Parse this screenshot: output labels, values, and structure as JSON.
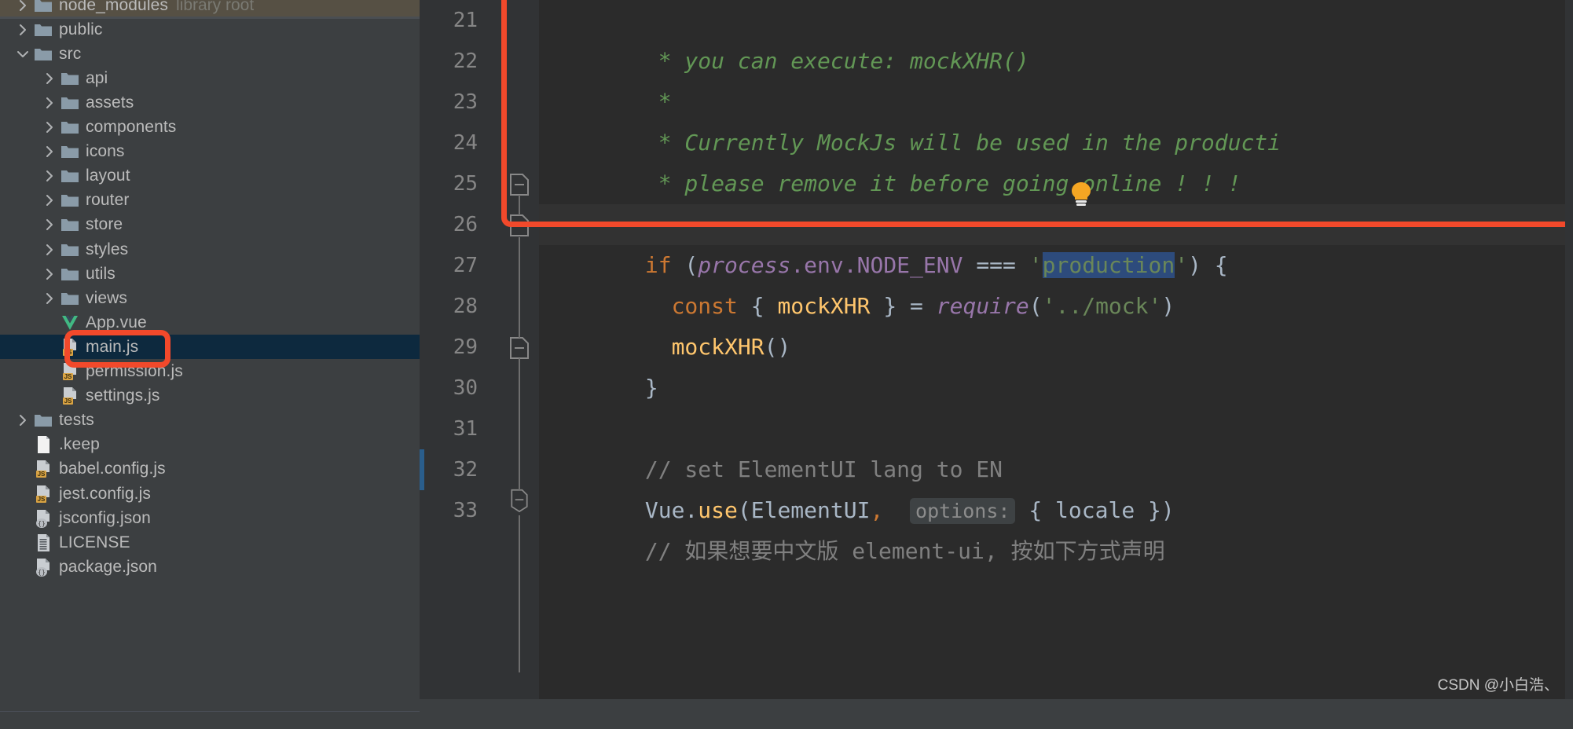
{
  "app": {
    "kind": "jetbrains-ide-project-view-and-editor",
    "accent_red": "#F2492B",
    "selection_blue": "#2D4B7C",
    "sidebar_bg": "#3C3F41",
    "editor_bg": "#2B2B2B",
    "gutter_bg": "#313335"
  },
  "sidebar": {
    "name": "project-tree",
    "items": [
      {
        "label": "node_modules",
        "suffix": "library root",
        "icon": "folder-icon",
        "arrow": "chevron-right-icon",
        "indent": 1,
        "state": "collapsed",
        "highlight": "olive",
        "partial_top": true
      },
      {
        "label": "public",
        "suffix": "",
        "icon": "folder-icon",
        "arrow": "chevron-right-icon",
        "indent": 1,
        "state": "collapsed",
        "highlight": "none"
      },
      {
        "label": "src",
        "suffix": "",
        "icon": "folder-icon",
        "arrow": "chevron-down-icon",
        "indent": 1,
        "state": "expanded",
        "highlight": "none"
      },
      {
        "label": "api",
        "suffix": "",
        "icon": "folder-icon",
        "arrow": "chevron-right-icon",
        "indent": 2,
        "state": "collapsed",
        "highlight": "none"
      },
      {
        "label": "assets",
        "suffix": "",
        "icon": "folder-icon",
        "arrow": "chevron-right-icon",
        "indent": 2,
        "state": "collapsed",
        "highlight": "none"
      },
      {
        "label": "components",
        "suffix": "",
        "icon": "folder-icon",
        "arrow": "chevron-right-icon",
        "indent": 2,
        "state": "collapsed",
        "highlight": "none"
      },
      {
        "label": "icons",
        "suffix": "",
        "icon": "folder-icon",
        "arrow": "chevron-right-icon",
        "indent": 2,
        "state": "collapsed",
        "highlight": "none"
      },
      {
        "label": "layout",
        "suffix": "",
        "icon": "folder-icon",
        "arrow": "chevron-right-icon",
        "indent": 2,
        "state": "collapsed",
        "highlight": "none"
      },
      {
        "label": "router",
        "suffix": "",
        "icon": "folder-icon",
        "arrow": "chevron-right-icon",
        "indent": 2,
        "state": "collapsed",
        "highlight": "none"
      },
      {
        "label": "store",
        "suffix": "",
        "icon": "folder-icon",
        "arrow": "chevron-right-icon",
        "indent": 2,
        "state": "collapsed",
        "highlight": "none"
      },
      {
        "label": "styles",
        "suffix": "",
        "icon": "folder-icon",
        "arrow": "chevron-right-icon",
        "indent": 2,
        "state": "collapsed",
        "highlight": "none"
      },
      {
        "label": "utils",
        "suffix": "",
        "icon": "folder-icon",
        "arrow": "chevron-right-icon",
        "indent": 2,
        "state": "collapsed",
        "highlight": "none"
      },
      {
        "label": "views",
        "suffix": "",
        "icon": "folder-icon",
        "arrow": "chevron-right-icon",
        "indent": 2,
        "state": "collapsed",
        "highlight": "none"
      },
      {
        "label": "App.vue",
        "suffix": "",
        "icon": "vue-file-icon",
        "arrow": "",
        "indent": 2,
        "state": "file",
        "highlight": "none"
      },
      {
        "label": "main.js",
        "suffix": "",
        "icon": "js-file-icon",
        "arrow": "",
        "indent": 2,
        "state": "file",
        "highlight": "selected"
      },
      {
        "label": "permission.js",
        "suffix": "",
        "icon": "js-file-icon",
        "arrow": "",
        "indent": 2,
        "state": "file",
        "highlight": "none"
      },
      {
        "label": "settings.js",
        "suffix": "",
        "icon": "js-file-icon",
        "arrow": "",
        "indent": 2,
        "state": "file",
        "highlight": "none"
      },
      {
        "label": "tests",
        "suffix": "",
        "icon": "folder-icon",
        "arrow": "chevron-right-icon",
        "indent": 1,
        "state": "collapsed",
        "highlight": "none"
      },
      {
        "label": ".keep",
        "suffix": "",
        "icon": "blank-file-icon",
        "arrow": "",
        "indent": 1,
        "state": "file",
        "highlight": "none"
      },
      {
        "label": "babel.config.js",
        "suffix": "",
        "icon": "js-file-icon",
        "arrow": "",
        "indent": 1,
        "state": "file",
        "highlight": "none"
      },
      {
        "label": "jest.config.js",
        "suffix": "",
        "icon": "js-file-icon",
        "arrow": "",
        "indent": 1,
        "state": "file",
        "highlight": "none"
      },
      {
        "label": "jsconfig.json",
        "suffix": "",
        "icon": "json-file-icon",
        "arrow": "",
        "indent": 1,
        "state": "file",
        "highlight": "none"
      },
      {
        "label": "LICENSE",
        "suffix": "",
        "icon": "text-file-icon",
        "arrow": "",
        "indent": 1,
        "state": "file",
        "highlight": "none"
      },
      {
        "label": "package.json",
        "suffix": "",
        "icon": "json-file-icon",
        "arrow": "",
        "indent": 1,
        "state": "file",
        "highlight": "none",
        "partial_bottom": true
      }
    ]
  },
  "editor": {
    "name": "code-editor-main-js",
    "line_numbers": [
      "21",
      "22",
      "23",
      "24",
      "25",
      "26",
      "27",
      "28",
      "29",
      "30",
      "31",
      "32",
      "33"
    ],
    "lines": [
      {
        "n": "21",
        "text": " * you can execute: mockXHR()"
      },
      {
        "n": "22",
        "text": " *"
      },
      {
        "n": "23",
        "text": " * Currently MockJs will be used in the producti"
      },
      {
        "n": "24",
        "text": " * please remove it before going online ! ! !"
      },
      {
        "n": "25",
        "text": " */"
      },
      {
        "n": "26",
        "text": "if (process.env.NODE_ENV === 'production') {"
      },
      {
        "n": "27",
        "text": "  const { mockXHR } = require('../mock')"
      },
      {
        "n": "28",
        "text": "  mockXHR()"
      },
      {
        "n": "29",
        "text": "}"
      },
      {
        "n": "30",
        "text": ""
      },
      {
        "n": "31",
        "text": "// set ElementUI lang to EN"
      },
      {
        "n": "32",
        "text": "Vue.use(ElementUI, options: { locale })"
      },
      {
        "n": "33",
        "text": "// 如果想要中文版 element-ui, 按如下方式声明"
      }
    ],
    "tokens": {
      "l21_comment": " * you can execute: mockXHR()",
      "l22_comment": " *",
      "l23_comment": " * Currently MockJs will be used in the producti",
      "l24_comment": " * please remove it before going online ! ! !",
      "l25_comment": "*/",
      "l26_if": "if",
      "l26_paren_open": " (",
      "l26_process": "process",
      "l26_envpath": ".env.NODE_ENV",
      "l26_eq": " === ",
      "l26_quote1": "'",
      "l26_production": "production",
      "l26_quote2": "'",
      "l26_tail": ") {",
      "l27_indent": "  ",
      "l27_const": "const",
      "l27_brace_open": " { ",
      "l27_mockxhr": "mockXHR",
      "l27_brace_close": " } ",
      "l27_assign": "= ",
      "l27_require": "require",
      "l27_paren_open": "(",
      "l27_path": "'../mock'",
      "l27_paren_close": ")",
      "l28_indent": "  ",
      "l28_mockxhr": "mockXHR",
      "l28_call": "()",
      "l29_close": "}",
      "l31_comment": "// set ElementUI lang to EN",
      "l32_vue": "Vue.",
      "l32_use": "use",
      "l32_paren_open": "(",
      "l32_elementui": "ElementUI",
      "l32_comma": ",",
      "l32_hint": "options:",
      "l32_locale": "{ locale }",
      "l32_paren_close": ")",
      "l33_comment": "// 如果想要中文版 element-ui, 按如下方式声明"
    }
  },
  "annotations": {
    "code_box": {
      "name": "red-highlight-box-code",
      "target": "lines 25-29 if(process.env.NODE_ENV==='production') block"
    },
    "file_box": {
      "name": "red-highlight-box-mainjs",
      "target": "main.js"
    },
    "bulb": {
      "name": "intention-bulb-icon",
      "tooltip": ""
    }
  },
  "watermark": {
    "text": "CSDN @小白浩、"
  }
}
